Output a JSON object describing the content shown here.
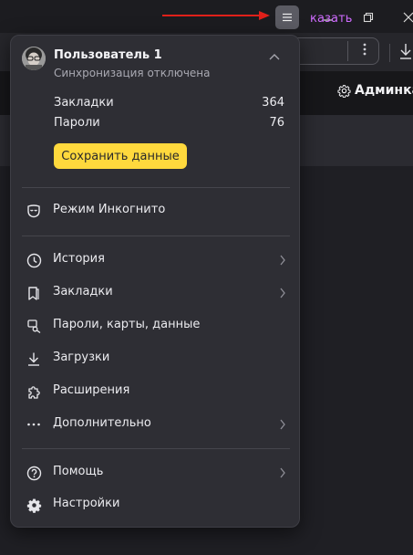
{
  "window": {
    "menu_button_icon": "hamburger-icon",
    "controls": [
      "minimize-icon",
      "restore-icon",
      "close-icon"
    ],
    "annotation_color": "#e0201a"
  },
  "toolbar": {
    "pill_text": "казать",
    "pill_text_color": "#cf6bff"
  },
  "bookmarks_bar": {
    "admin_label": "Админка"
  },
  "menu": {
    "profile": {
      "name": "Пользователь 1",
      "sync_status": "Синхронизация отключена"
    },
    "stats": [
      {
        "label": "Закладки",
        "value": "364"
      },
      {
        "label": "Пароли",
        "value": "76"
      }
    ],
    "save_button": {
      "label": "Сохранить данные",
      "color": "#ffd93d"
    },
    "incognito": {
      "label": "Режим Инкогнито",
      "icon": "incognito-mask-icon"
    },
    "items": [
      {
        "label": "История",
        "icon": "clock-icon",
        "has_submenu": true
      },
      {
        "label": "Закладки",
        "icon": "bookmark-icon",
        "has_submenu": true
      },
      {
        "label": "Пароли, карты, данные",
        "icon": "key-card-icon",
        "has_submenu": false
      },
      {
        "label": "Загрузки",
        "icon": "download-icon",
        "has_submenu": false
      },
      {
        "label": "Расширения",
        "icon": "puzzle-icon",
        "has_submenu": false
      },
      {
        "label": "Дополнительно",
        "icon": "more-dots-icon",
        "has_submenu": true
      }
    ],
    "footer_items": [
      {
        "label": "Помощь",
        "icon": "help-icon",
        "has_submenu": true
      },
      {
        "label": "Настройки",
        "icon": "gear-icon",
        "has_submenu": false
      }
    ]
  }
}
